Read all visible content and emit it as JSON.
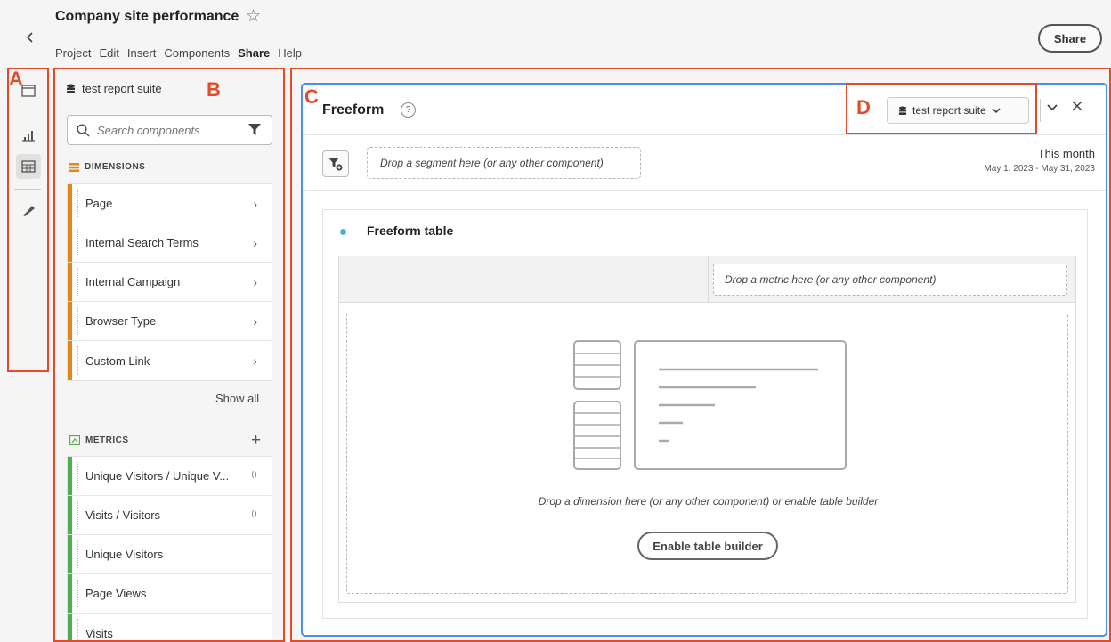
{
  "header": {
    "back_icon": "chevron-left-icon",
    "project_title": "Company site performance",
    "star_icon": "star-outline-icon",
    "menu": [
      "Project",
      "Edit",
      "Insert",
      "Components",
      "Share",
      "Help"
    ],
    "active_menu": "Share",
    "share_button": "Share"
  },
  "rail": {
    "icons": [
      "panels-icon",
      "visualizations-icon",
      "components-icon",
      "tools-icon"
    ],
    "active_icon": "components-icon"
  },
  "components_panel": {
    "report_suite": "test report suite",
    "search_placeholder": "Search components",
    "dimensions_header": "DIMENSIONS",
    "dimensions": [
      "Page",
      "Internal Search Terms",
      "Internal Campaign",
      "Browser Type",
      "Custom Link"
    ],
    "show_all": "Show all",
    "metrics_header": "METRICS",
    "metrics": [
      {
        "label": "Unique Visitors / Unique V...",
        "calculated": true
      },
      {
        "label": "Visits / Visitors",
        "calculated": true
      },
      {
        "label": "Unique Visitors",
        "calculated": false
      },
      {
        "label": "Page Views",
        "calculated": false
      },
      {
        "label": "Visits",
        "calculated": false
      }
    ],
    "dimension_color": "#e68619",
    "metric_color": "#4caf50"
  },
  "freeform_panel": {
    "title": "Freeform",
    "report_suite": "test report suite",
    "segment_drop": "Drop a segment here (or any other component)",
    "date_label": "This month",
    "date_range": "May 1, 2023 - May 31, 2023",
    "table": {
      "title": "Freeform table",
      "metric_drop": "Drop a metric here (or any other component)",
      "dimension_drop": "Drop a dimension here (or any other component) or enable table builder",
      "enable_button": "Enable table builder"
    },
    "accent_color": "#4b8fe8"
  },
  "annotations": {
    "labels": [
      "A",
      "B",
      "C",
      "D"
    ],
    "color": "#e34b2a"
  }
}
